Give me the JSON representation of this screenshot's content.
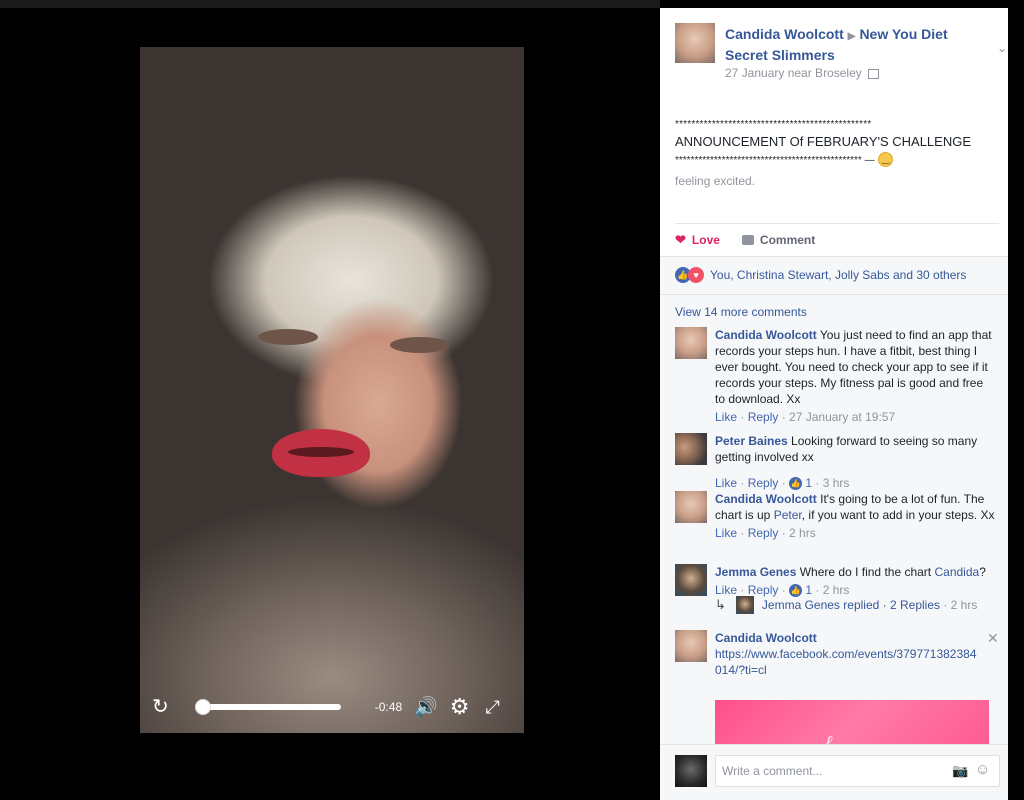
{
  "post": {
    "author": "Candida Woolcott",
    "group": "New You Diet Secret Slimmers",
    "meta": "27 January near Broseley",
    "stars_line1": "************************************************",
    "announcement": "ANNOUNCEMENT Of FEBRUARY'S CHALLENGE",
    "stars_line2": "************************************************ —",
    "feeling": "feeling excited."
  },
  "actions": {
    "love": "Love",
    "comment": "Comment"
  },
  "reactions": {
    "summary": "You, Christina Stewart, Jolly Sabs and 30 others"
  },
  "comments": {
    "view_more": "View 14 more comments",
    "items": [
      {
        "name": "Candida Woolcott",
        "text": "You just need to find an app that records your steps hun. I have a fitbit, best thing I ever bought. You need to check your app to see if it records your steps. My fitness pal is good and free to download. Xx",
        "like": "Like",
        "reply": "Reply",
        "time": "27 January at 19:57"
      },
      {
        "name": "Peter Baines",
        "text": "Looking forward to seeing so many getting involved xx",
        "like": "Like",
        "reply": "Reply",
        "likes": "1",
        "time": "3 hrs"
      },
      {
        "name": "Candida Woolcott",
        "text_before": "It's going to be a lot of fun. The chart is up ",
        "mention": "Peter",
        "text_after": ", if you want to add in your steps. Xx",
        "like": "Like",
        "reply": "Reply",
        "time": "2 hrs"
      },
      {
        "name": "Jemma Genes",
        "text_before": "Where do I find the chart ",
        "mention": "Candida",
        "text_after": "?",
        "like": "Like",
        "reply": "Reply",
        "likes": "1",
        "time": "2 hrs"
      }
    ],
    "reply_summary": {
      "name": "Jemma Genes",
      "text": "replied · 2 Replies",
      "time": "· 2 hrs"
    },
    "pending": {
      "name": "Candida Woolcott",
      "link": "https://www.facebook.com/events/379771382384014/?ti=cl"
    }
  },
  "composer": {
    "placeholder": "Write a comment..."
  },
  "video": {
    "time_remaining": "-0:48",
    "progress": 0.0
  },
  "icons": {
    "replay": "replay-icon",
    "volume": "volume-icon",
    "settings": "gear-icon",
    "fullscreen": "fullscreen-icon",
    "camera": "camera-icon",
    "emoji": "smiley-icon"
  },
  "colors": {
    "link": "#365899",
    "love": "#e0245e",
    "muted": "#90949c"
  }
}
